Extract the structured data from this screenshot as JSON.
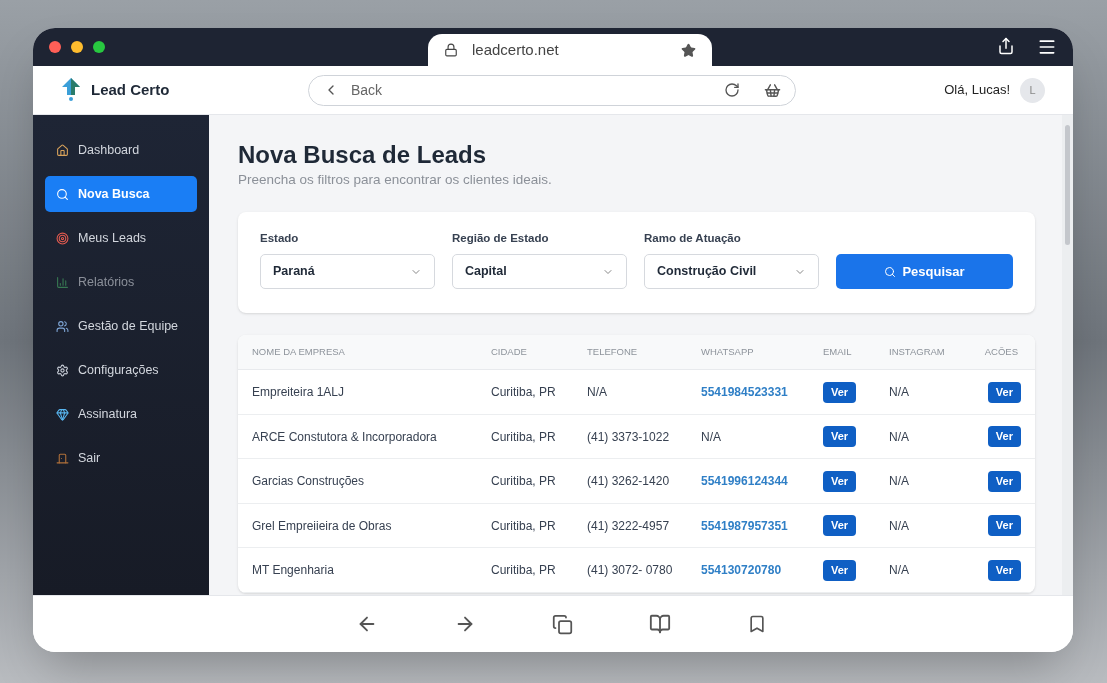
{
  "browser": {
    "url": "leadcerto.net",
    "nav_back": "Back"
  },
  "app": {
    "brand": "Lead Certo",
    "greeting": "Olá, Lucas!",
    "avatar": "L"
  },
  "sidebar": {
    "items": [
      {
        "label": "Dashboard",
        "selected": false,
        "disabled": false
      },
      {
        "label": "Nova Busca",
        "selected": true,
        "disabled": false
      },
      {
        "label": "Meus Leads",
        "selected": false,
        "disabled": false
      },
      {
        "label": "Relatórios",
        "selected": false,
        "disabled": true
      },
      {
        "label": "Gestão de Equipe",
        "selected": false,
        "disabled": false
      },
      {
        "label": "Configurações",
        "selected": false,
        "disabled": false
      },
      {
        "label": "Assinatura",
        "selected": false,
        "disabled": false
      },
      {
        "label": "Sair",
        "selected": false,
        "disabled": false
      }
    ]
  },
  "page": {
    "title": "Nova Busca de Leads",
    "subtitle": "Preencha os filtros para encontrar os clientes ideais."
  },
  "filters": [
    {
      "label": "Estado",
      "value": "Paraná"
    },
    {
      "label": "Região de Estado",
      "value": "Capital"
    },
    {
      "label": "Ramo de Atuação",
      "value": "Construção Civil"
    }
  ],
  "search_button": "Pesquisar",
  "table": {
    "columns": [
      "NOME DA EMPRESA",
      "CIDADE",
      "TELEFONE",
      "WHATSAPP",
      "EMAIL",
      "INSTAGRAM",
      "ACÕES"
    ],
    "rows": [
      {
        "name": "Empreiteira 1ALJ",
        "city": "Curitiba, PR",
        "phone": "N/A",
        "whatsapp": "5541984523331",
        "whatsapp_link": true,
        "email": "Ver",
        "instagram": "N/A",
        "action": "Ver"
      },
      {
        "name": "ARCE Constutora & Incorporadora",
        "city": "Curitiba, PR",
        "phone": "(41) 3373-1022",
        "whatsapp": "N/A",
        "whatsapp_link": false,
        "email": "Ver",
        "instagram": "N/A",
        "action": "Ver"
      },
      {
        "name": "Garcias Construções",
        "city": "Curitiba, PR",
        "phone": "(41) 3262-1420",
        "whatsapp": "5541996124344",
        "whatsapp_link": true,
        "email": "Ver",
        "instagram": "N/A",
        "action": "Ver"
      },
      {
        "name": "Grel Empreiieira de Obras",
        "city": "Curitiba, PR",
        "phone": "(41) 3222-4957",
        "whatsapp": "5541987957351",
        "whatsapp_link": true,
        "email": "Ver",
        "instagram": "N/A",
        "action": "Ver"
      },
      {
        "name": "MT Engenharia",
        "city": "Curitiba, PR",
        "phone": "(41) 3072- 0780",
        "whatsapp": "554130720780",
        "whatsapp_link": true,
        "email": "Ver",
        "instagram": "N/A",
        "action": "Ver"
      }
    ]
  }
}
